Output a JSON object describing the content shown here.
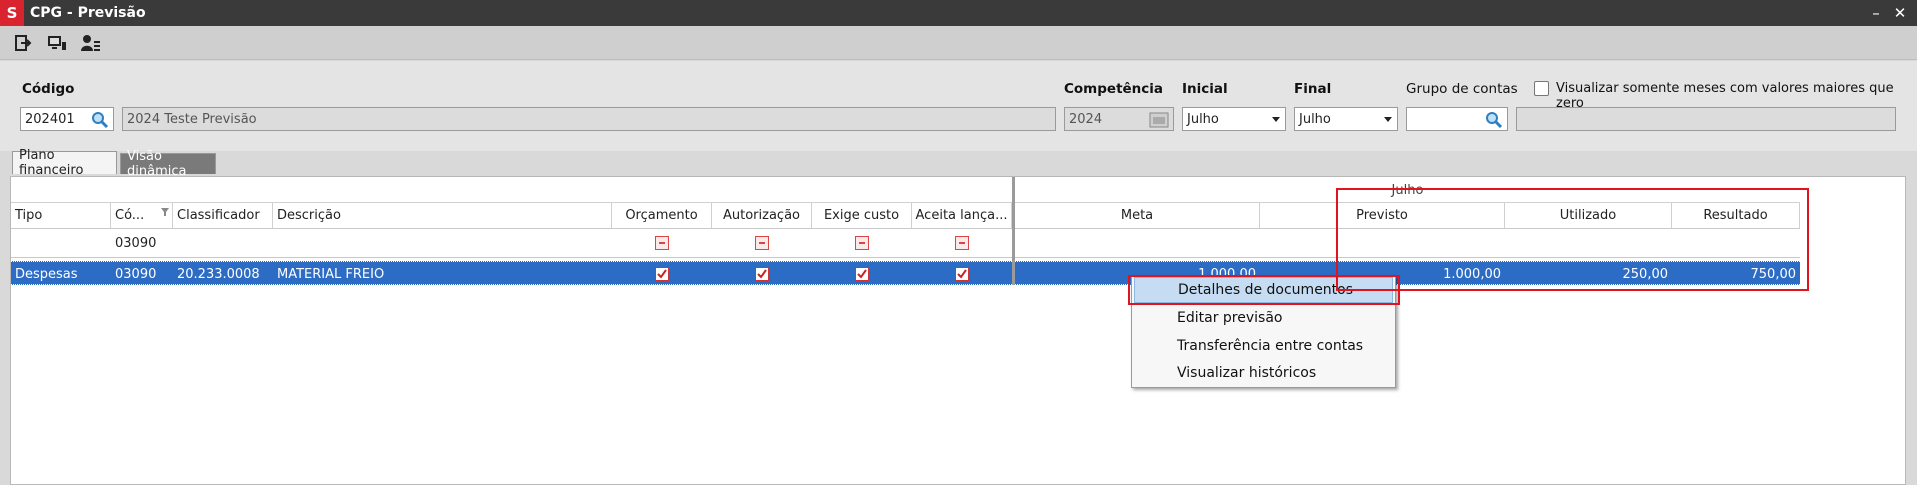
{
  "window": {
    "title": "CPG - Previsão",
    "logo_letter": "S",
    "minimize_label": "–",
    "close_label": "✕"
  },
  "toolbar": {
    "buttons": [
      {
        "icon": "exit-icon"
      },
      {
        "icon": "monitor-icon"
      },
      {
        "icon": "user-list-icon"
      }
    ]
  },
  "form": {
    "codigo_label": "Código",
    "codigo_value": "202401",
    "descricao_value": "2024 Teste Previsão",
    "competencia_label": "Competência",
    "competencia_value": "2024",
    "inicial_label": "Inicial",
    "inicial_value": "Julho",
    "final_label": "Final",
    "final_value": "Julho",
    "grupo_label": "Grupo de contas",
    "grupo_value": "",
    "grupo_desc_value": "",
    "visualizar_label": "Visualizar somente meses com valores maiores que zero",
    "visualizar_checked": false
  },
  "tabs": [
    {
      "label": "Plano financeiro",
      "active": true
    },
    {
      "label": "Visão dinâmica",
      "active": false
    }
  ],
  "grid": {
    "band_label": "Julho",
    "columns": {
      "tipo": "Tipo",
      "codigo": "Có...",
      "classificador": "Classificador",
      "descricao": "Descrição",
      "orcamento": "Orçamento",
      "autorizacao": "Autorização",
      "exige_custo": "Exige custo",
      "aceita": "Aceita lança...",
      "meta": "Meta",
      "previsto": "Previsto",
      "utilizado": "Utilizado",
      "resultado": "Resultado"
    },
    "filter_row": {
      "codigo": "03090"
    },
    "rows": [
      {
        "tipo": "Despesas",
        "codigo": "03090",
        "classificador": "20.233.0008",
        "descricao": "MATERIAL FREIO",
        "orcamento": true,
        "autorizacao": true,
        "exige_custo": true,
        "aceita": true,
        "meta": "1.000,00",
        "previsto": "1.000,00",
        "utilizado": "250,00",
        "resultado": "750,00"
      }
    ]
  },
  "context_menu": {
    "items": [
      {
        "label": "Detalhes de documentos",
        "highlighted": true
      },
      {
        "label": "Editar previsão",
        "highlighted": false
      },
      {
        "label": "Transferência entre contas",
        "highlighted": false
      },
      {
        "label": "Visualizar históricos",
        "highlighted": false
      }
    ]
  },
  "colors": {
    "selection": "#2c6cc4",
    "annotation": "#e0141e",
    "title_bar": "#3a3a3a",
    "logo": "#d9232e"
  }
}
